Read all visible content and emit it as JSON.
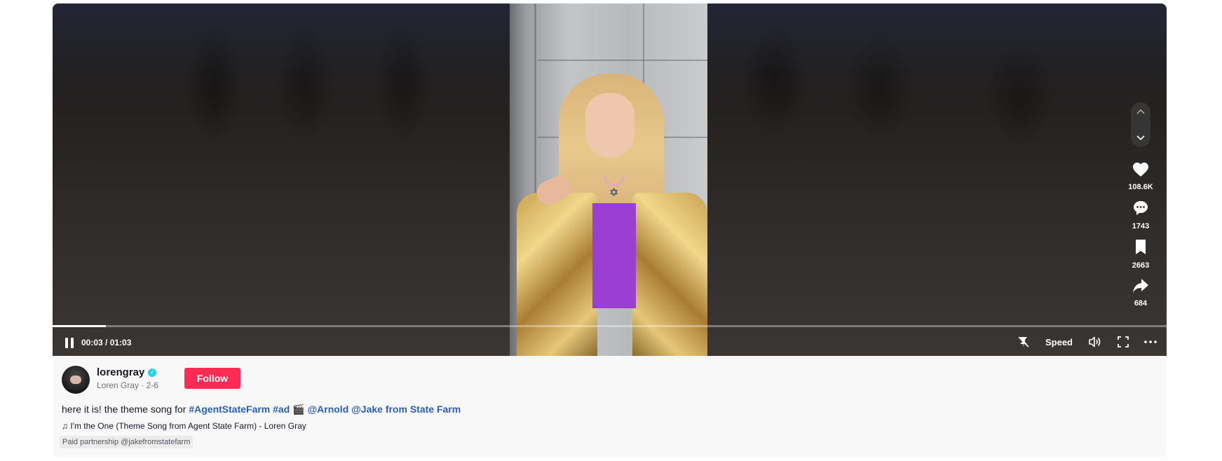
{
  "player": {
    "time_display": "00:03 / 01:03",
    "progress": 0.0476,
    "speed_label": "Speed",
    "icons": {
      "pause": "pause-icon",
      "floating": "floating-player-icon",
      "volume": "volume-icon",
      "fullscreen": "fullscreen-icon",
      "more": "more-options-icon",
      "nav_up": "chevron-up-icon",
      "nav_down": "chevron-down-icon"
    }
  },
  "actions": {
    "like": {
      "icon": "heart-icon",
      "count": "108.6K"
    },
    "comment": {
      "icon": "comment-icon",
      "count": "1743"
    },
    "save": {
      "icon": "bookmark-icon",
      "count": "2663"
    },
    "share": {
      "icon": "share-icon",
      "count": "684"
    }
  },
  "author": {
    "username": "lorengray",
    "display_name_date": "Loren Gray · 2-6",
    "verified": true
  },
  "follow_label": "Follow",
  "caption": {
    "text_prefix": "here it is! the theme song for",
    "hashtag1": "#AgentStateFarm",
    "hashtag2": "#ad",
    "emoji": "🎬",
    "mention1": "@Arnold",
    "mention2": "@Jake from State Farm"
  },
  "music": {
    "icon": "music-note-icon",
    "title": "♫ I'm the One (Theme Song from Agent State Farm) - Loren Gray"
  },
  "paid_partnership": "Paid partnership @jakefromstatefarm",
  "colors": {
    "follow_button": "#fe2c55",
    "link": "#2b5db9",
    "verified": "#20d5ec"
  }
}
